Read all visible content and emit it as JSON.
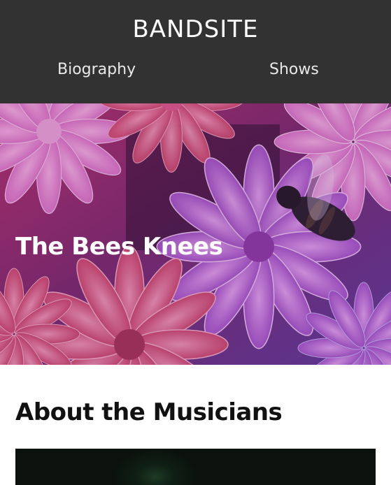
{
  "header": {
    "brand": "BANDSITE",
    "nav": [
      {
        "label": "Biography"
      },
      {
        "label": "Shows"
      }
    ]
  },
  "hero": {
    "title": "The Bees Knees"
  },
  "about": {
    "title": "About the Musicians"
  },
  "colors": {
    "header_bg": "#323232",
    "header_text": "#ffffff",
    "page_bg": "#ffffff",
    "heading_text": "#111111"
  }
}
